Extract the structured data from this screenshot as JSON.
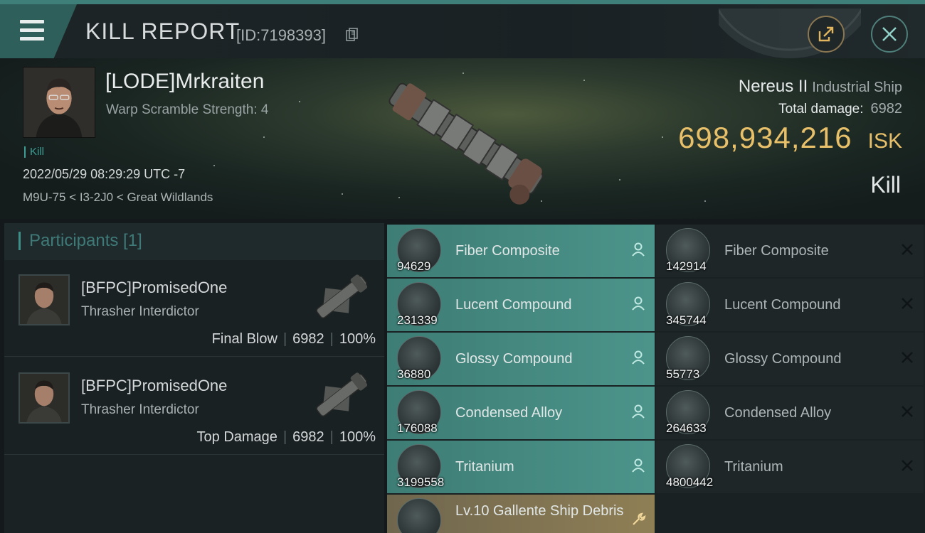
{
  "header": {
    "title": "KILL REPORT",
    "id_text": "[ID:7198393]"
  },
  "victim": {
    "name": "[LODE]Mrkraiten",
    "warp_scramble": "Warp Scramble Strength: 4",
    "tag": "Kill",
    "datetime": "2022/05/29 08:29:29 UTC -7",
    "location": "M9U-75 < I3-2J0 < Great Wildlands"
  },
  "summary": {
    "ship_name": "Nereus II",
    "ship_class": "Industrial Ship",
    "total_damage_label": "Total damage:",
    "total_damage_value": "6982",
    "isk_amount": "698,934,216",
    "isk_unit": "ISK",
    "result": "Kill"
  },
  "participants": {
    "title": "Participants [1]",
    "rows": [
      {
        "name": "[BFPC]PromisedOne",
        "ship": "Thrasher Interdictor",
        "role": "Final Blow",
        "damage": "6982",
        "percent": "100%"
      },
      {
        "name": "[BFPC]PromisedOne",
        "ship": "Thrasher Interdictor",
        "role": "Top Damage",
        "damage": "6982",
        "percent": "100%"
      }
    ]
  },
  "items": {
    "dropped": [
      {
        "name": "Fiber Composite",
        "qty": "94629",
        "icon": "fiber-composite-icon"
      },
      {
        "name": "Lucent Compound",
        "qty": "231339",
        "icon": "lucent-compound-icon"
      },
      {
        "name": "Glossy Compound",
        "qty": "36880",
        "icon": "glossy-compound-icon"
      },
      {
        "name": "Condensed Alloy",
        "qty": "176088",
        "icon": "condensed-alloy-icon"
      },
      {
        "name": "Tritanium",
        "qty": "3199558",
        "icon": "tritanium-icon"
      },
      {
        "name": "Lv.10 Gallente Ship Debris",
        "qty": "",
        "icon": "ship-debris-icon"
      }
    ],
    "destroyed": [
      {
        "name": "Fiber Composite",
        "qty": "142914",
        "icon": "fiber-composite-icon"
      },
      {
        "name": "Lucent Compound",
        "qty": "345744",
        "icon": "lucent-compound-icon"
      },
      {
        "name": "Glossy Compound",
        "qty": "55773",
        "icon": "glossy-compound-icon"
      },
      {
        "name": "Condensed Alloy",
        "qty": "264633",
        "icon": "condensed-alloy-icon"
      },
      {
        "name": "Tritanium",
        "qty": "4800442",
        "icon": "tritanium-icon"
      }
    ]
  },
  "colors": {
    "accent": "#3e7f79",
    "isk": "#e8c06a",
    "dropped": "#4a8f86",
    "special": "#8a7a52"
  }
}
